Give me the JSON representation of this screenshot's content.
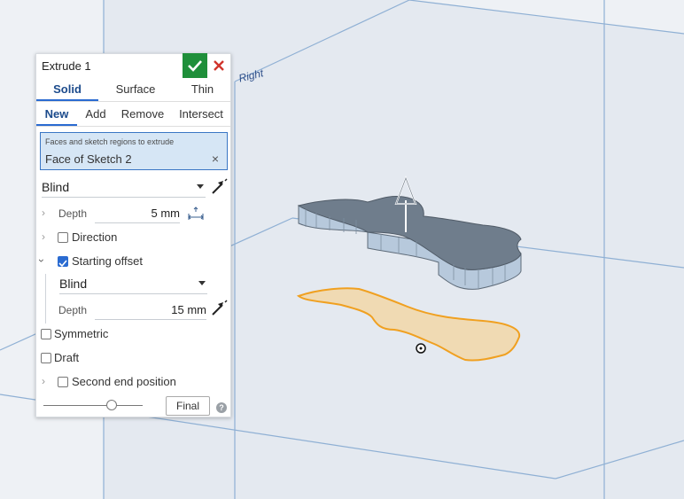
{
  "panel": {
    "title": "Extrude 1",
    "tabs_type": [
      "Solid",
      "Surface",
      "Thin"
    ],
    "active_type": "Solid",
    "tabs_op": [
      "New",
      "Add",
      "Remove",
      "Intersect"
    ],
    "active_op": "New",
    "selection": {
      "label": "Faces and sketch regions to extrude",
      "value": "Face of Sketch 2",
      "clear_glyph": "×"
    },
    "end_type": "Blind",
    "depth": {
      "label": "Depth",
      "value": "5 mm"
    },
    "direction": {
      "label": "Direction",
      "checked": false
    },
    "starting_offset": {
      "label": "Starting offset",
      "checked": true,
      "type": "Blind",
      "depth_label": "Depth",
      "depth_value": "15 mm"
    },
    "symmetric": {
      "label": "Symmetric",
      "checked": false
    },
    "draft": {
      "label": "Draft",
      "checked": false
    },
    "second_end": {
      "label": "Second end position",
      "checked": false
    },
    "final_label": "Final",
    "help_glyph": "?",
    "slider_fraction": 0.7,
    "icons": [
      "check-icon",
      "close-icon",
      "flip-direction-icon",
      "measure-arrows-icon",
      "help-icon"
    ]
  },
  "viewport": {
    "plane_label": "Right",
    "colors": {
      "background": "#eef1f5",
      "plane_line": "#8fb0d4",
      "plane_fill": "#dfe6ef",
      "solid_top": "#6f7d8c",
      "solid_side": "#b7c9dc",
      "sketch_fill": "#f1d8ac",
      "sketch_stroke": "#f0a020",
      "accent": "#2a6bd1",
      "ok": "#1f8f3a",
      "cancel": "#d0342c"
    }
  }
}
